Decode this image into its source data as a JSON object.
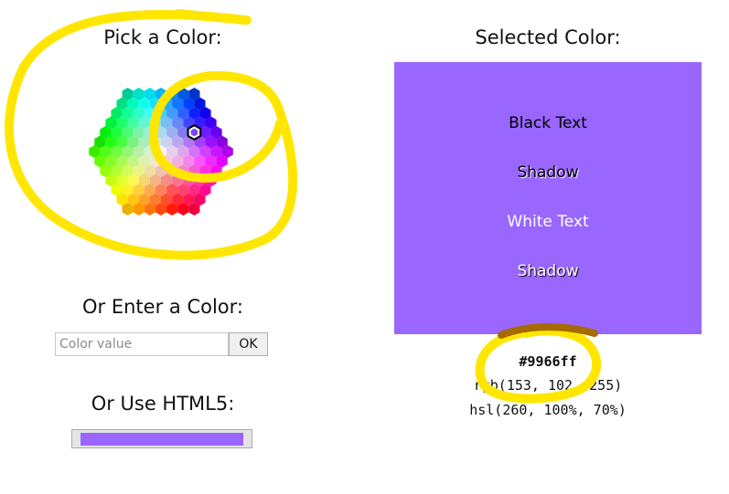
{
  "left": {
    "pick_title": "Pick a Color:",
    "enter_title": "Or Enter a Color:",
    "input_placeholder": "Color value",
    "ok_label": "OK",
    "html5_title": "Or Use HTML5:"
  },
  "right": {
    "title": "Selected Color:",
    "samples": [
      "Black Text",
      "Shadow",
      "White Text",
      "Shadow"
    ],
    "hex": "#9966ff",
    "rgb": "rgb(153, 102, 255)",
    "hsl": "hsl(260, 100%, 70%)"
  },
  "colors": {
    "selected": "#9966ff",
    "annotation": "#ffe600",
    "annotation_dark": "#a56b00"
  }
}
